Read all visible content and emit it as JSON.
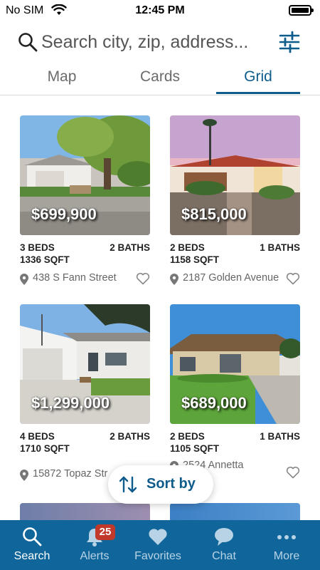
{
  "status_bar": {
    "carrier": "No SIM",
    "time": "12:45 PM"
  },
  "search": {
    "placeholder": "Search city, zip, address..."
  },
  "tabs": [
    {
      "label": "Map",
      "active": false
    },
    {
      "label": "Cards",
      "active": false
    },
    {
      "label": "Grid",
      "active": true
    }
  ],
  "listings": [
    {
      "price": "$699,900",
      "beds": "3 BEDS",
      "baths": "2 BATHS",
      "sqft": "1336 SQFT",
      "address": "438 S Fann Street"
    },
    {
      "price": "$815,000",
      "beds": "2 BEDS",
      "baths": "1 BATHS",
      "sqft": "1158 SQFT",
      "address": "2187 Golden Avenue"
    },
    {
      "price": "$1,299,000",
      "beds": "4 BEDS",
      "baths": "2 BATHS",
      "sqft": "1710 SQFT",
      "address": "15872 Topaz Str"
    },
    {
      "price": "$689,000",
      "beds": "2 BEDS",
      "baths": "1 BATHS",
      "sqft": "1105 SQFT",
      "address": "2524 Annetta Place"
    }
  ],
  "sort": {
    "label": "Sort by",
    "icon": "sort-arrows-icon"
  },
  "bottom_nav": [
    {
      "label": "Search",
      "icon": "search-icon",
      "active": true
    },
    {
      "label": "Alerts",
      "icon": "bell-icon",
      "badge": "25"
    },
    {
      "label": "Favorites",
      "icon": "heart-icon"
    },
    {
      "label": "Chat",
      "icon": "chat-bubble-icon"
    },
    {
      "label": "More",
      "icon": "more-dots-icon"
    }
  ],
  "colors": {
    "accent": "#0e5c8c",
    "nav_background": "#10669a",
    "badge": "#c0392b"
  }
}
